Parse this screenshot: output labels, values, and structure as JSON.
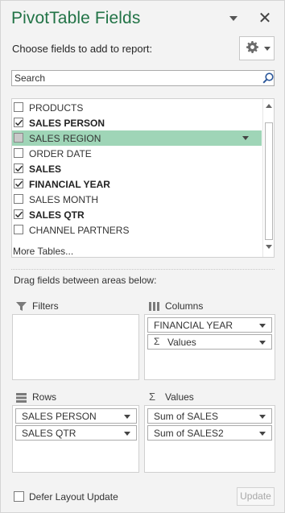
{
  "header": {
    "title": "PivotTable Fields",
    "dropdown_icon": "chevron-down-icon",
    "close_glyph": "✕"
  },
  "fields_section": {
    "label": "Choose fields to add to report:",
    "gear_icon": "gear-icon"
  },
  "search": {
    "placeholder": "Search",
    "value": ""
  },
  "fields": [
    {
      "label": "PRODUCTS",
      "checked": false,
      "bold": false
    },
    {
      "label": "SALES PERSON",
      "checked": true,
      "bold": true
    },
    {
      "label": "SALES REGION",
      "checked": false,
      "bold": false,
      "highlighted": true
    },
    {
      "label": "ORDER DATE",
      "checked": false,
      "bold": false
    },
    {
      "label": "SALES",
      "checked": true,
      "bold": true
    },
    {
      "label": "FINANCIAL YEAR",
      "checked": true,
      "bold": true
    },
    {
      "label": "SALES MONTH",
      "checked": false,
      "bold": false
    },
    {
      "label": "SALES QTR",
      "checked": true,
      "bold": true
    },
    {
      "label": "CHANNEL PARTNERS",
      "checked": false,
      "bold": false
    }
  ],
  "more_tables": "More Tables...",
  "areas": {
    "instruction": "Drag fields between areas below:",
    "filters": {
      "title": "Filters",
      "items": []
    },
    "columns": {
      "title": "Columns",
      "items": [
        "FINANCIAL YEAR",
        "Values"
      ]
    },
    "rows": {
      "title": "Rows",
      "items": [
        "SALES PERSON",
        "SALES QTR"
      ]
    },
    "values": {
      "title": "Values",
      "items": [
        "Sum of SALES",
        "Sum of SALES2"
      ]
    },
    "sigma_glyph": "Σ"
  },
  "footer": {
    "defer_label": "Defer Layout Update",
    "defer_checked": false,
    "update_label": "Update"
  },
  "colors": {
    "title": "#217346",
    "highlight": "#9fd5b7"
  }
}
